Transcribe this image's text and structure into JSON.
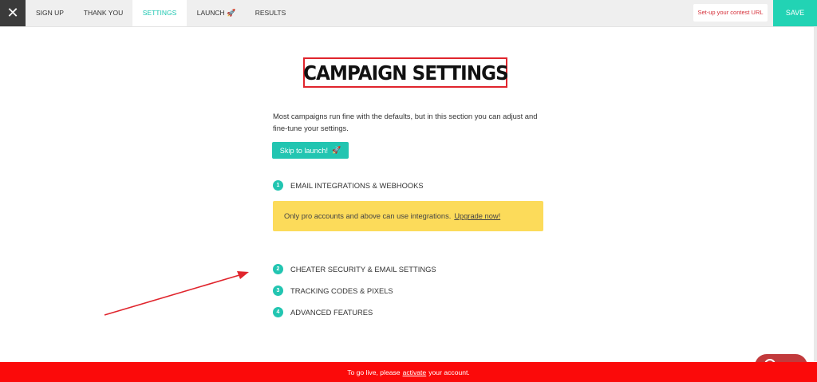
{
  "topbar": {
    "close_icon": "close-icon",
    "close_glyph": "✕",
    "tabs": [
      {
        "label": "SIGN UP",
        "active": false
      },
      {
        "label": "THANK YOU",
        "active": false
      },
      {
        "label": "SETTINGS",
        "active": true
      },
      {
        "label": "LAUNCH",
        "icon": "rocket-icon",
        "active": false
      },
      {
        "label": "RESULTS",
        "active": false
      }
    ],
    "contest_url_label": "Set-up your contest URL",
    "save_label": "SAVE"
  },
  "main": {
    "title": "CAMPAIGN SETTINGS",
    "intro": "Most campaigns run fine with the defaults, but in this section you can adjust and fine-tune your settings.",
    "skip_label": "Skip to launch!",
    "sections": [
      {
        "number": "1",
        "label": "EMAIL INTEGRATIONS & WEBHOOKS"
      },
      {
        "number": "2",
        "label": "CHEATER SECURITY & EMAIL SETTINGS"
      },
      {
        "number": "3",
        "label": "TRACKING CODES & PIXELS"
      },
      {
        "number": "4",
        "label": "ADVANCED FEATURES"
      }
    ],
    "notice": {
      "text": "Only pro accounts and above can use integrations.",
      "link": "Upgrade now!"
    }
  },
  "banner": {
    "before": "To go live, please",
    "link": "activate",
    "after": "your account."
  },
  "colors": {
    "accent": "#22c5b1",
    "save": "#22d3b4",
    "notice_bg": "#fcdb5a",
    "banner_bg": "#fb0a0a",
    "highlight": "#e0252d"
  }
}
